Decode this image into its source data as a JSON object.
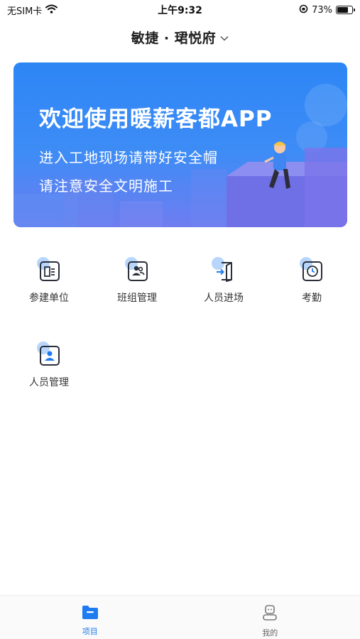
{
  "status_bar": {
    "carrier": "无SIM卡",
    "time": "上午9:32",
    "battery_percent": "73%",
    "battery_level": 0.73
  },
  "header": {
    "project_name": "敏捷 · 珺悦府"
  },
  "banner": {
    "title": "欢迎使用暖薪客都APP",
    "line1": "进入工地现场请带好安全帽",
    "line2": "请注意安全文明施工"
  },
  "menu": {
    "items": [
      {
        "label": "参建单位",
        "icon": "building-list-icon"
      },
      {
        "label": "班组管理",
        "icon": "team-icon"
      },
      {
        "label": "人员进场",
        "icon": "door-enter-icon"
      },
      {
        "label": "考勤",
        "icon": "clock-icon"
      },
      {
        "label": "人员管理",
        "icon": "person-card-icon"
      }
    ]
  },
  "tab_bar": {
    "tabs": [
      {
        "label": "项目",
        "icon": "folder-icon",
        "active": true
      },
      {
        "label": "我的",
        "icon": "user-icon",
        "active": false
      }
    ]
  },
  "colors": {
    "accent": "#1e7bf0",
    "icon_stroke": "#2b2f3a",
    "icon_dot": "#b8d6fb"
  }
}
